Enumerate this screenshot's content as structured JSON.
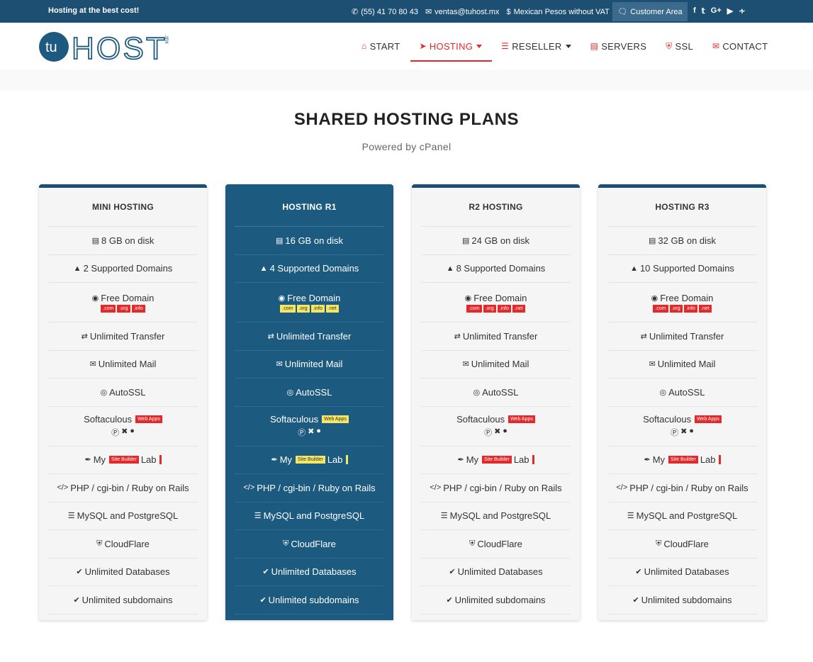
{
  "topbar": {
    "tagline": "Hosting at the best cost!",
    "phone": "(55) 41 70 80 43",
    "email": "ventas@tuhost.mx",
    "currency": "Mexican Pesos without VAT",
    "customer_area": "Customer Area",
    "social": [
      "f",
      "t",
      "G+",
      "yt",
      "rss"
    ]
  },
  "logo": {
    "text_a": "tu",
    "text_b": "HOST",
    "text_c": ".mx"
  },
  "nav": [
    {
      "label": "START",
      "icon": "home-icon"
    },
    {
      "label": "HOSTING",
      "icon": "rocket-icon",
      "active": true,
      "dropdown": true
    },
    {
      "label": "RESELLER",
      "icon": "database-icon",
      "dropdown": true
    },
    {
      "label": "SERVERS",
      "icon": "server-icon"
    },
    {
      "label": "SSL",
      "icon": "shield-icon"
    },
    {
      "label": "CONTACT",
      "icon": "envelope-icon"
    }
  ],
  "page": {
    "title": "SHARED HOSTING PLANS",
    "subtitle": "Powered by cPanel"
  },
  "plans": [
    {
      "name": "MINI HOSTING",
      "disk": "8 GB on disk",
      "domains": "2 Supported Domains",
      "free_domain": "Free Domain",
      "tlds": [
        ".com",
        ".org",
        ".info"
      ],
      "transfer": "Unlimited Transfer",
      "mail": "Unlimited Mail",
      "autossl": "AutoSSL",
      "softaculous": "Softaculous",
      "softaculous_badge": "Web Apps",
      "sitebuilder_pre": "My",
      "sitebuilder_badge": "Site Builder",
      "sitebuilder_post": "Lab",
      "languages": "PHP / cgi-bin / Ruby on Rails",
      "db_engines": "MySQL and PostgreSQL",
      "cloudflare": "CloudFlare",
      "databases": "Unlimited Databases",
      "subdomains": "Unlimited subdomains"
    },
    {
      "name": "HOSTING R1",
      "disk": "16 GB on disk",
      "domains": "4 Supported Domains",
      "free_domain": "Free Domain",
      "tlds": [
        ".com",
        ".org",
        ".info",
        ".net"
      ],
      "transfer": "Unlimited Transfer",
      "mail": "Unlimited Mail",
      "autossl": "AutoSSL",
      "softaculous": "Softaculous",
      "softaculous_badge": "Web Apps",
      "sitebuilder_pre": "My",
      "sitebuilder_badge": "Site Builder",
      "sitebuilder_post": "Lab",
      "languages": "PHP / cgi-bin / Ruby on Rails",
      "db_engines": "MySQL and PostgreSQL",
      "cloudflare": "CloudFlare",
      "databases": "Unlimited Databases",
      "subdomains": "Unlimited subdomains"
    },
    {
      "name": "R2 HOSTING",
      "disk": "24 GB on disk",
      "domains": "8 Supported Domains",
      "free_domain": "Free Domain",
      "tlds": [
        ".com",
        ".org",
        ".info",
        ".net"
      ],
      "transfer": "Unlimited Transfer",
      "mail": "Unlimited Mail",
      "autossl": "AutoSSL",
      "softaculous": "Softaculous",
      "softaculous_badge": "Web Apps",
      "sitebuilder_pre": "My",
      "sitebuilder_badge": "Site Builder",
      "sitebuilder_post": "Lab",
      "languages": "PHP / cgi-bin / Ruby on Rails",
      "db_engines": "MySQL and PostgreSQL",
      "cloudflare": "CloudFlare",
      "databases": "Unlimited Databases",
      "subdomains": "Unlimited subdomains"
    },
    {
      "name": "HOSTING R3",
      "disk": "32 GB on disk",
      "domains": "10 Supported Domains",
      "free_domain": "Free Domain",
      "tlds": [
        ".com",
        ".org",
        ".info",
        ".net"
      ],
      "transfer": "Unlimited Transfer",
      "mail": "Unlimited Mail",
      "autossl": "AutoSSL",
      "softaculous": "Softaculous",
      "softaculous_badge": "Web Apps",
      "sitebuilder_pre": "My",
      "sitebuilder_badge": "Site Builder",
      "sitebuilder_post": "Lab",
      "languages": "PHP / cgi-bin / Ruby on Rails",
      "db_engines": "MySQL and PostgreSQL",
      "cloudflare": "CloudFlare",
      "databases": "Unlimited Databases",
      "subdomains": "Unlimited subdomains"
    }
  ],
  "colors": {
    "brand": "#1d4f72",
    "accent": "#e32929",
    "featured": "#1d5a80",
    "highlight": "#f5e663"
  }
}
